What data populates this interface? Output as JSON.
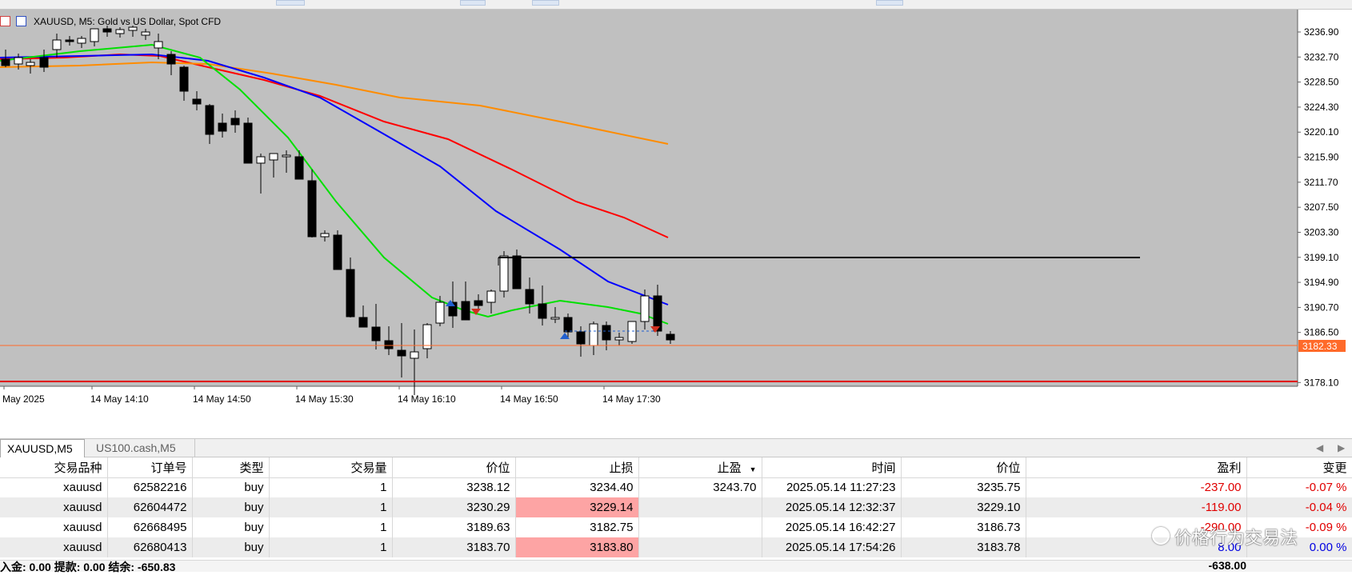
{
  "chart": {
    "title": "XAUUSD, M5:  Gold vs US Dollar, Spot CFD",
    "price_labels": [
      "3236.90",
      "3232.70",
      "3228.50",
      "3224.30",
      "3220.10",
      "3215.90",
      "3211.70",
      "3207.50",
      "3203.30",
      "3199.10",
      "3194.90",
      "3190.70",
      "3186.50",
      "3178.10"
    ],
    "current_price": "3182.33",
    "time_labels": [
      "May 2025",
      "14 May 14:10",
      "14 May 14:50",
      "14 May 15:30",
      "14 May 16:10",
      "14 May 16:50",
      "14 May 17:30"
    ],
    "colors": {
      "background": "#c0c0c0",
      "ma_green": "#00e000",
      "ma_blue": "#0000ff",
      "ma_red": "#ff0000",
      "ma_orange": "#ff8c00",
      "bid_line": "#ff6a2a",
      "stop_line": "#e00000"
    }
  },
  "tabs": [
    {
      "label": "XAUUSD,M5",
      "active": true
    },
    {
      "label": "US100.cash,M5",
      "active": false
    }
  ],
  "table": {
    "headers": [
      "交易品种",
      "订单号",
      "类型",
      "交易量",
      "价位",
      "止损",
      "止盈",
      "时间",
      "价位",
      "盈利",
      "变更"
    ],
    "rows": [
      {
        "symbol": "xauusd",
        "order": "62582216",
        "type": "buy",
        "volume": "1",
        "open": "3238.12",
        "sl": "3234.40",
        "tp": "3243.70",
        "time": "2025.05.14 11:27:23",
        "price": "3235.75",
        "profit": "-237.00",
        "change": "-0.07 %"
      },
      {
        "symbol": "xauusd",
        "order": "62604472",
        "type": "buy",
        "volume": "1",
        "open": "3230.29",
        "sl": "3229.14",
        "tp": "",
        "time": "2025.05.14 12:32:37",
        "price": "3229.10",
        "profit": "-119.00",
        "change": "-0.04 %"
      },
      {
        "symbol": "xauusd",
        "order": "62668495",
        "type": "buy",
        "volume": "1",
        "open": "3189.63",
        "sl": "3182.75",
        "tp": "",
        "time": "2025.05.14 16:42:27",
        "price": "3186.73",
        "profit": "-290.00",
        "change": "-0.09 %"
      },
      {
        "symbol": "xauusd",
        "order": "62680413",
        "type": "buy",
        "volume": "1",
        "open": "3183.70",
        "sl": "3183.80",
        "tp": "",
        "time": "2025.05.14 17:54:26",
        "price": "3183.78",
        "profit": "8.00",
        "change": "0.00 %"
      }
    ]
  },
  "status": {
    "left": "入金: 0.00  提款: 0.00  结余: -650.83",
    "right": "-638.00"
  },
  "watermark": "价格行为交易法"
}
